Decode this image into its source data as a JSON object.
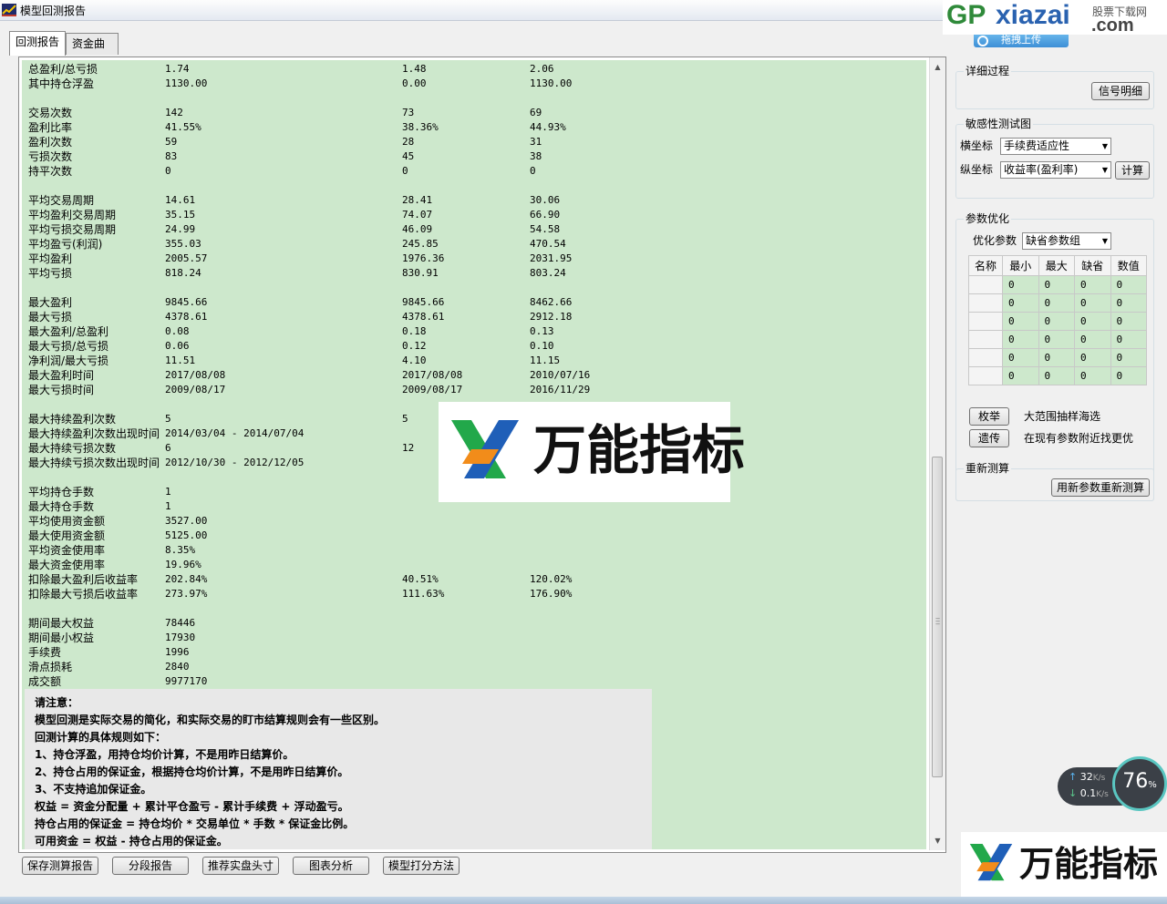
{
  "window": {
    "title": "模型回测报告"
  },
  "tabs": [
    {
      "label": "回测报告",
      "active": true
    },
    {
      "label": "资金曲线",
      "active": false
    }
  ],
  "stats": [
    {
      "label": "总盈利/总亏损",
      "values": [
        "1.74",
        "1.48",
        "2.06"
      ]
    },
    {
      "label": "其中持仓浮盈",
      "values": [
        "1130.00",
        "0.00",
        "1130.00"
      ]
    },
    {
      "label": "交易次数",
      "values": [
        "142",
        "73",
        "69"
      ]
    },
    {
      "label": "盈利比率",
      "values": [
        "41.55%",
        "38.36%",
        "44.93%"
      ]
    },
    {
      "label": "盈利次数",
      "values": [
        "59",
        "28",
        "31"
      ]
    },
    {
      "label": "亏损次数",
      "values": [
        "83",
        "45",
        "38"
      ]
    },
    {
      "label": "持平次数",
      "values": [
        "0",
        "0",
        "0"
      ]
    },
    {
      "label": "平均交易周期",
      "values": [
        "14.61",
        "28.41",
        "30.06"
      ]
    },
    {
      "label": "平均盈利交易周期",
      "values": [
        "35.15",
        "74.07",
        "66.90"
      ]
    },
    {
      "label": "平均亏损交易周期",
      "values": [
        "24.99",
        "46.09",
        "54.58"
      ]
    },
    {
      "label": "平均盈亏(利润)",
      "values": [
        "355.03",
        "245.85",
        "470.54"
      ]
    },
    {
      "label": "平均盈利",
      "values": [
        "2005.57",
        "1976.36",
        "2031.95"
      ]
    },
    {
      "label": "平均亏损",
      "values": [
        "818.24",
        "830.91",
        "803.24"
      ]
    },
    {
      "label": "最大盈利",
      "values": [
        "9845.66",
        "9845.66",
        "8462.66"
      ]
    },
    {
      "label": "最大亏损",
      "values": [
        "4378.61",
        "4378.61",
        "2912.18"
      ]
    },
    {
      "label": "最大盈利/总盈利",
      "values": [
        "0.08",
        "0.18",
        "0.13"
      ]
    },
    {
      "label": "最大亏损/总亏损",
      "values": [
        "0.06",
        "0.12",
        "0.10"
      ]
    },
    {
      "label": "净利润/最大亏损",
      "values": [
        "11.51",
        "4.10",
        "11.15"
      ]
    },
    {
      "label": "最大盈利时间",
      "values": [
        "2017/08/08",
        "2017/08/08",
        "2010/07/16"
      ]
    },
    {
      "label": "最大亏损时间",
      "values": [
        "2009/08/17",
        "2009/08/17",
        "2016/11/29"
      ]
    },
    {
      "label": "最大持续盈利次数",
      "values": [
        "5",
        "5",
        ""
      ]
    },
    {
      "label": "最大持续盈利次数出现时间",
      "values": [
        "2014/03/04 - 2014/07/04",
        "",
        ""
      ]
    },
    {
      "label": "最大持续亏损次数",
      "values": [
        "6",
        "12",
        ""
      ]
    },
    {
      "label": "最大持续亏损次数出现时间",
      "values": [
        "2012/10/30 - 2012/12/05",
        "",
        ""
      ]
    },
    {
      "label": "平均持仓手数",
      "values": [
        "1",
        "",
        ""
      ]
    },
    {
      "label": "最大持仓手数",
      "values": [
        "1",
        "",
        ""
      ]
    },
    {
      "label": "平均使用资金额",
      "values": [
        "3527.00",
        "",
        ""
      ]
    },
    {
      "label": "最大使用资金额",
      "values": [
        "5125.00",
        "",
        ""
      ]
    },
    {
      "label": "平均资金使用率",
      "values": [
        "8.35%",
        "",
        ""
      ]
    },
    {
      "label": "最大资金使用率",
      "values": [
        "19.96%",
        "",
        ""
      ]
    },
    {
      "label": "扣除最大盈利后收益率",
      "values": [
        "202.84%",
        "40.51%",
        "120.02%"
      ]
    },
    {
      "label": "扣除最大亏损后收益率",
      "values": [
        "273.97%",
        "111.63%",
        "176.90%"
      ]
    },
    {
      "label": "期间最大权益",
      "values": [
        "78446",
        "",
        ""
      ]
    },
    {
      "label": "期间最小权益",
      "values": [
        "17930",
        "",
        ""
      ]
    },
    {
      "label": "手续费",
      "values": [
        "1996",
        "",
        ""
      ]
    },
    {
      "label": "滑点损耗",
      "values": [
        "2840",
        "",
        ""
      ]
    },
    {
      "label": "成交额",
      "values": [
        "9977170",
        "",
        ""
      ]
    }
  ],
  "notes": [
    "请注意：",
    "模型回测是实际交易的简化，和实际交易的盯市结算规则会有一些区别。",
    "回测计算的具体规则如下：",
    "1、持仓浮盈，用持仓均价计算，不是用昨日结算价。",
    "2、持仓占用的保证金，根据持仓均价计算，不是用昨日结算价。",
    "3、不支持追加保证金。",
    "权益 = 资金分配量 + 累计平仓盈亏 - 累计手续费 + 浮动盈亏。",
    "持仓占用的保证金 = 持仓均价 * 交易单位 * 手数 * 保证金比例。",
    "可用资金 = 权益 - 持仓占用的保证金。"
  ],
  "bottom_buttons": [
    "保存测算报告",
    "分段报告",
    "推荐实盘头寸",
    "图表分析",
    "模型打分方法"
  ],
  "right_panel": {
    "detail": {
      "title": "详细过程",
      "button": "信号明细"
    },
    "sensitivity": {
      "title": "敏感性测试图",
      "x_label": "横坐标",
      "x_value": "手续费适应性",
      "y_label": "纵坐标",
      "y_value": "收益率(盈利率)",
      "calc_button": "计算"
    },
    "optimize": {
      "title": "参数优化",
      "param_label": "优化参数",
      "param_value": "缺省参数组",
      "columns": [
        "名称",
        "最小",
        "最大",
        "缺省",
        "数值"
      ],
      "rows": [
        [
          "",
          "0",
          "0",
          "0",
          "0"
        ],
        [
          "",
          "0",
          "0",
          "0",
          "0"
        ],
        [
          "",
          "0",
          "0",
          "0",
          "0"
        ],
        [
          "",
          "0",
          "0",
          "0",
          "0"
        ],
        [
          "",
          "0",
          "0",
          "0",
          "0"
        ],
        [
          "",
          "0",
          "0",
          "0",
          "0"
        ]
      ],
      "enum_button": "枚举",
      "enum_desc": "大范围抽样海选",
      "genetic_button": "遗传",
      "genetic_desc": "在现有参数附近找更优"
    },
    "recalc": {
      "title": "重新测算",
      "button": "用新参数重新测算"
    }
  },
  "watermarks": {
    "site_prefix": "GP",
    "site_name": "xiazai",
    "site_suffix": ".com",
    "site_tagline": "股票下载网",
    "upload_label": "拖拽上传",
    "brand": "万能指标"
  },
  "speed": {
    "percent": "76",
    "percent_unit": "%",
    "up": "32",
    "down": "0.1",
    "unit": "K/s"
  },
  "colors": {
    "report_bg": "#cde8cc",
    "notes_bg": "#e8e8e8",
    "accent": "#5ac6c1",
    "brand_green": "#22a84a",
    "brand_blue": "#1f5fb8"
  }
}
